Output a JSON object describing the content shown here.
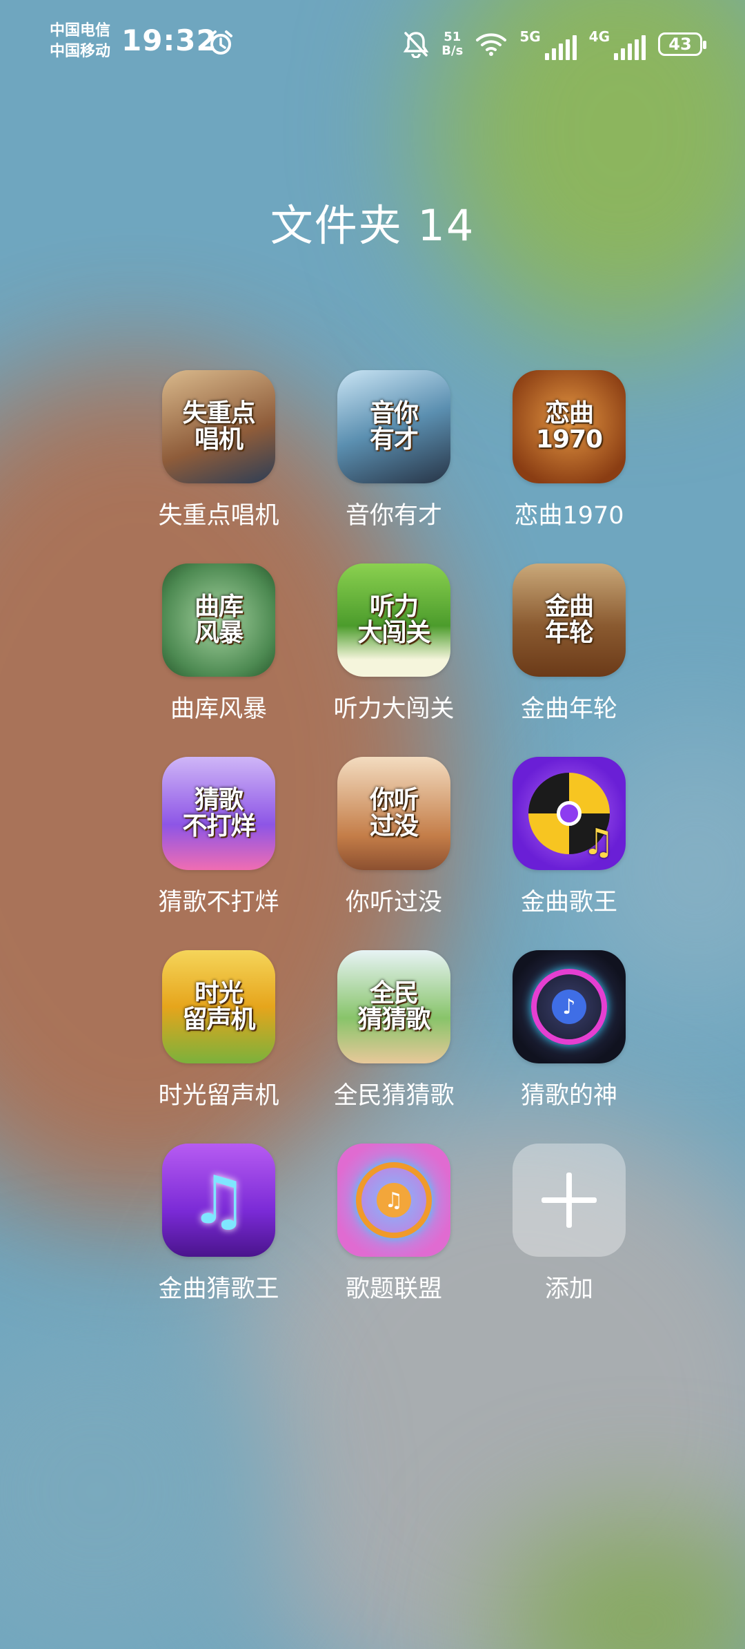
{
  "status_bar": {
    "carrier_1": "中国电信",
    "carrier_2": "中国移动",
    "time": "19:32",
    "net_speed_value": "51",
    "net_speed_unit": "B/s",
    "sim1_type": "5G",
    "sim2_type": "4G",
    "battery": "43"
  },
  "folder": {
    "title": "文件夹 14"
  },
  "apps": [
    {
      "label": "失重点唱机",
      "icon_text": "失重点\n唱机"
    },
    {
      "label": "音你有才",
      "icon_text": "音你\n有才"
    },
    {
      "label": "恋曲1970",
      "icon_text": "恋曲\n1970"
    },
    {
      "label": "曲库风暴",
      "icon_text": "曲库\n风暴"
    },
    {
      "label": "听力大闯关",
      "icon_text": "听力\n大闯关"
    },
    {
      "label": "金曲年轮",
      "icon_text": "金曲\n年轮"
    },
    {
      "label": "猜歌不打烊",
      "icon_text": "猜歌\n不打烊"
    },
    {
      "label": "你听过没",
      "icon_text": "你听\n过没"
    },
    {
      "label": "金曲歌王",
      "icon_text": ""
    },
    {
      "label": "时光留声机",
      "icon_text": "时光\n留声机"
    },
    {
      "label": "全民猜猜歌",
      "icon_text": "全民\n猜猜歌"
    },
    {
      "label": "猜歌的神",
      "icon_text": ""
    },
    {
      "label": "金曲猜歌王",
      "icon_text": ""
    },
    {
      "label": "歌题联盟",
      "icon_text": ""
    },
    {
      "label": "添加",
      "icon_text": ""
    }
  ]
}
